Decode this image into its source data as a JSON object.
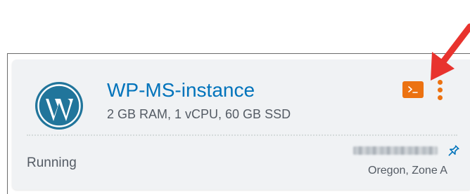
{
  "instance": {
    "name": "WP-MS-instance",
    "specs": "2 GB RAM, 1 vCPU, 60 GB SSD",
    "status": "Running",
    "ip_address": "",
    "location": "Oregon, Zone A",
    "blueprint_icon": "wordpress-logo-icon"
  },
  "actions": {
    "connect_icon": "terminal-icon",
    "menu_icon": "kebab-menu-icon",
    "pin_icon": "pin-icon"
  },
  "annotation": {
    "arrow_icon": "red-arrow-icon"
  },
  "colors": {
    "name_link": "#0073bb",
    "accent_orange": "#ec7211",
    "wordpress_blue": "#21759b",
    "arrow_red": "#e8332e",
    "card_background": "#f0f2f4",
    "secondary_text": "#545b64"
  }
}
